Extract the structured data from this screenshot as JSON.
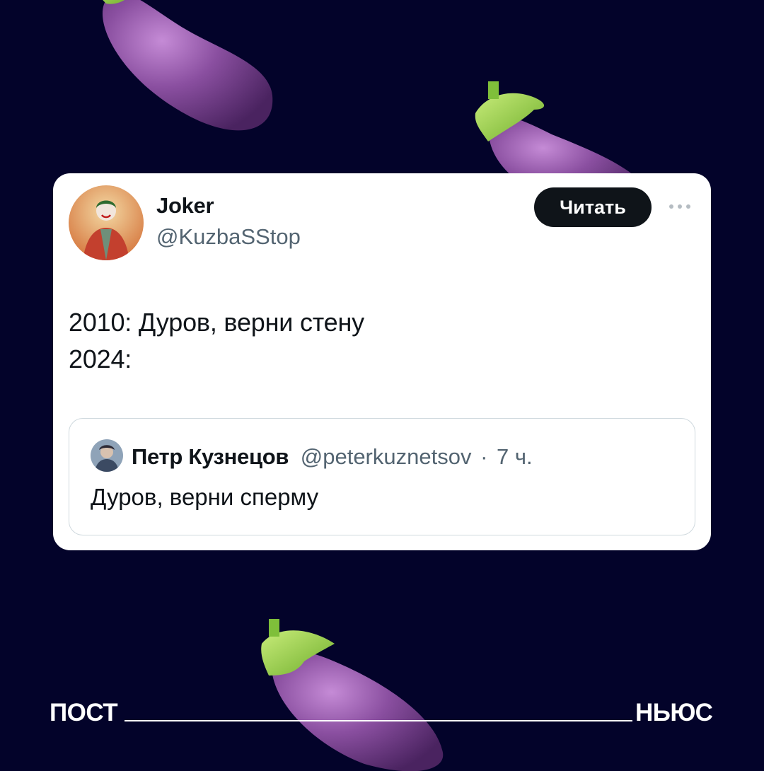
{
  "background_color": "#03032a",
  "decorations": {
    "icon": "eggplant-icon",
    "eggplant_color": "#8a4fa0",
    "stem_color": "#9ad24a"
  },
  "post": {
    "author": {
      "name": "Joker",
      "handle": "@KuzbaSStop",
      "avatar": "avatar-joker-icon"
    },
    "follow_label": "Читать",
    "more_icon": "more-icon",
    "text_lines": [
      "2010: Дуров, верни стену",
      "2024:"
    ],
    "quote": {
      "author_name": "Петр Кузнецов",
      "handle": "@peterkuznetsov",
      "separator": "·",
      "time": "7 ч.",
      "text": "Дуров, верни сперму",
      "avatar": "avatar-quote-icon"
    }
  },
  "footer": {
    "left": "ПОСТ",
    "right": "НЬЮС"
  }
}
